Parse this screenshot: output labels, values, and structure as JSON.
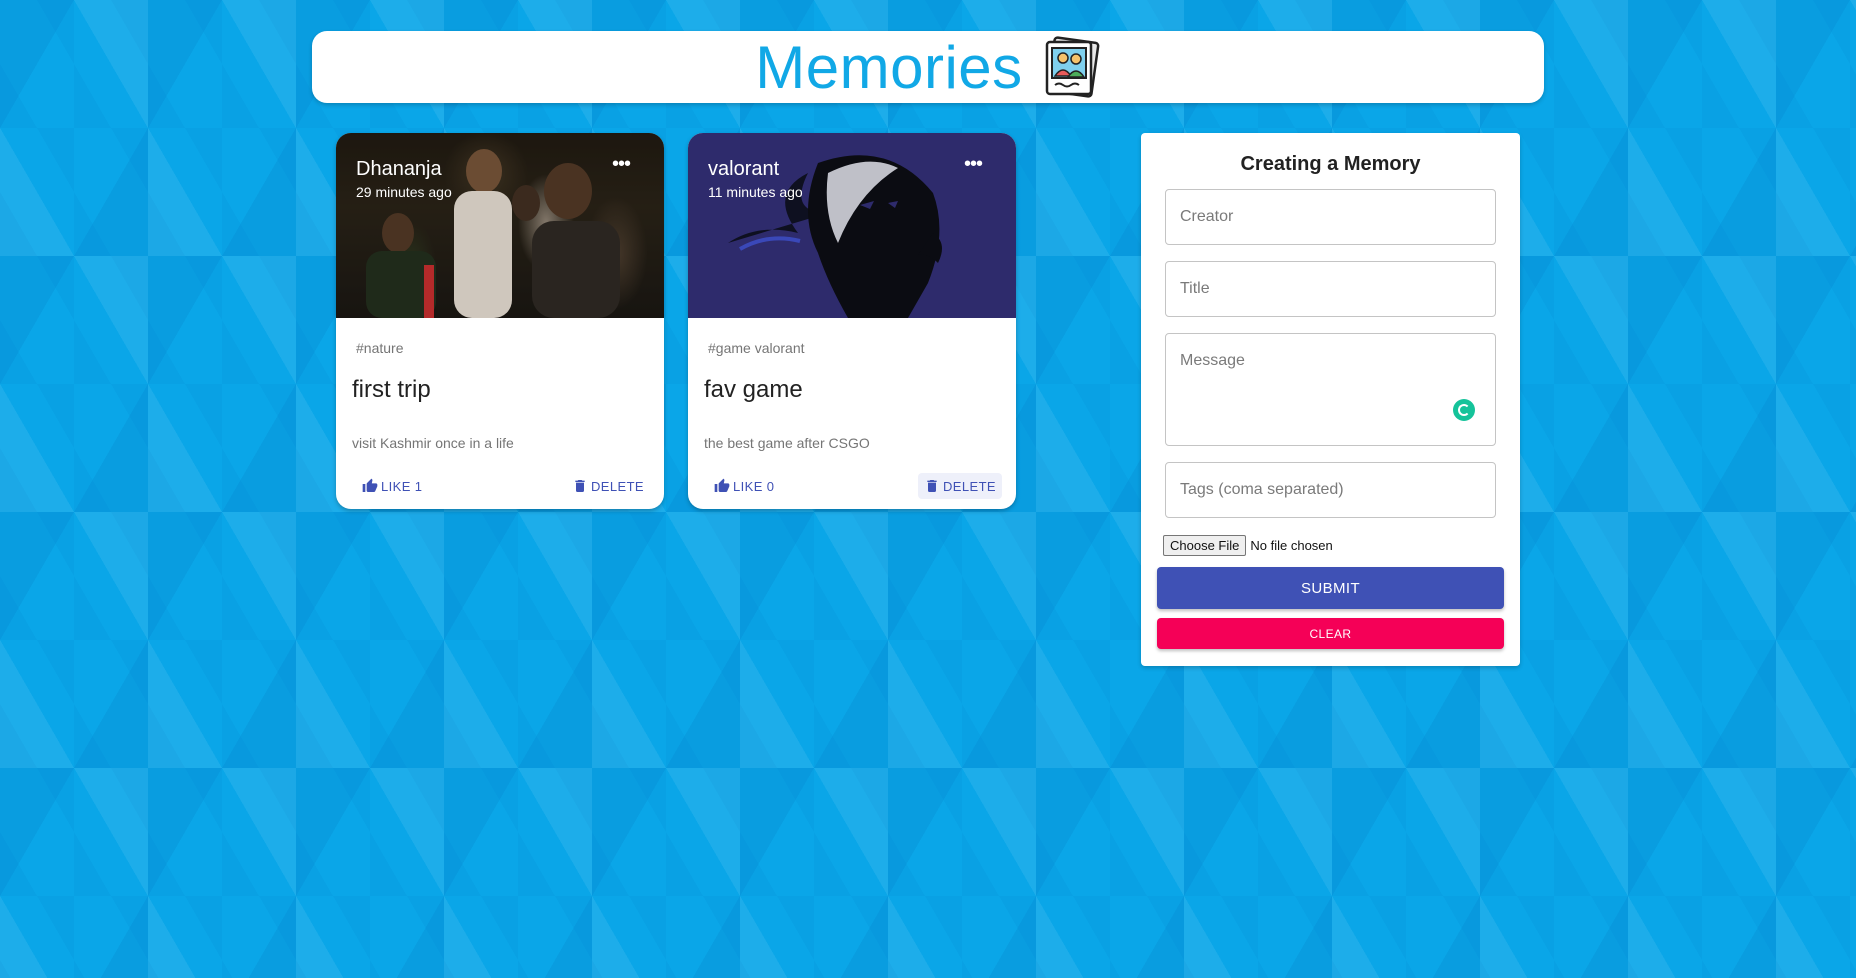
{
  "app": {
    "title": "Memories",
    "logo_icon": "photo-album-icon"
  },
  "posts": [
    {
      "creator": "Dhananja",
      "time": "29 minutes ago",
      "tags": "#nature",
      "title": "first trip",
      "message": "visit Kashmir once in a life",
      "like_label": "LIKE 1",
      "delete_label": "DELETE"
    },
    {
      "creator": "valorant",
      "time": "11 minutes ago",
      "tags": "#game valorant",
      "title": "fav game",
      "message": "the best game after CSGO",
      "like_label": "LIKE 0",
      "delete_label": "DELETE"
    }
  ],
  "form": {
    "heading": "Creating a Memory",
    "creator_placeholder": "Creator",
    "title_placeholder": "Title",
    "message_placeholder": "Message",
    "tags_placeholder": "Tags (coma separated)",
    "file_button": "Choose File",
    "file_status": "No file chosen",
    "submit_label": "SUBMIT",
    "clear_label": "CLEAR"
  },
  "colors": {
    "accent": "#3f51b5",
    "secondary": "#f50057",
    "brand_title": "#11a8e6",
    "background": "#0aa6e8"
  }
}
